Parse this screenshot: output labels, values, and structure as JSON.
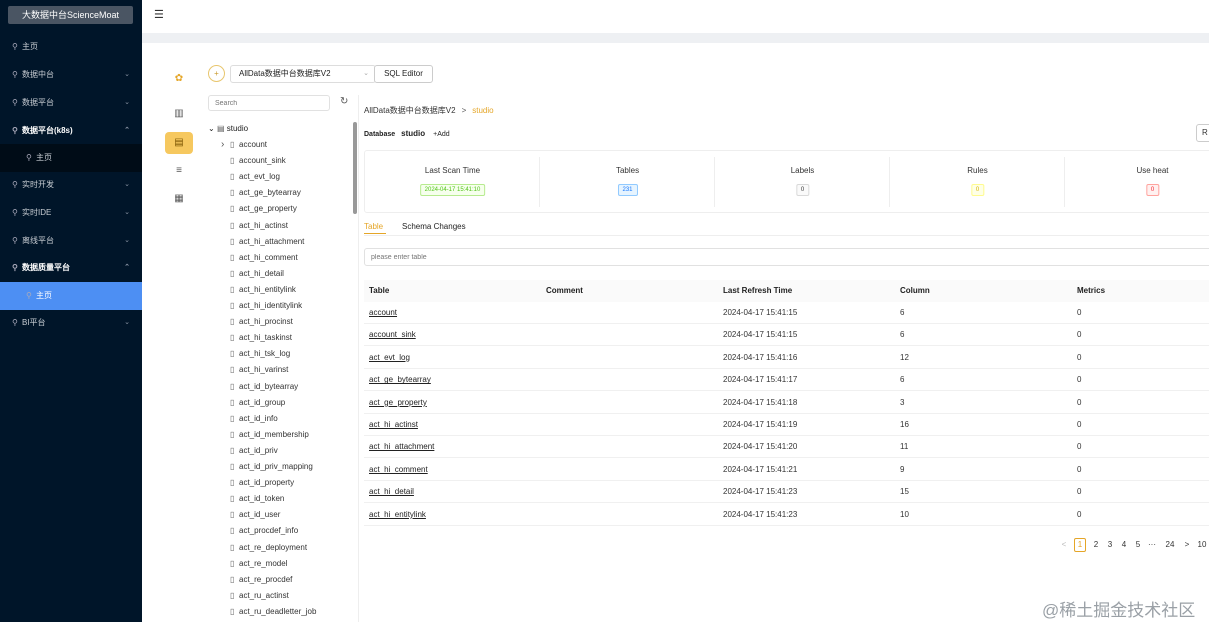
{
  "sidebar": {
    "brand": "大数据中台ScienceMoat",
    "items": [
      {
        "label": "主页",
        "chev": ""
      },
      {
        "label": "数据中台",
        "chev": "⌄"
      },
      {
        "label": "数据平台",
        "chev": "⌄"
      },
      {
        "label": "数据平台(k8s)",
        "chev": "⌃"
      },
      {
        "label": "主页",
        "chev": ""
      },
      {
        "label": "实时开发",
        "chev": "⌄"
      },
      {
        "label": "实时IDE",
        "chev": "⌄"
      },
      {
        "label": "离线平台",
        "chev": "⌄"
      },
      {
        "label": "数据质量平台",
        "chev": "⌃"
      },
      {
        "label": "主页",
        "chev": ""
      },
      {
        "label": "BI平台",
        "chev": "⌄"
      }
    ]
  },
  "toolbar": {
    "db_name": "AllData数据中台数据库V2",
    "sql_editor": "SQL Editor",
    "search_placeholder": "Search"
  },
  "tree": {
    "root": "studio",
    "items": [
      "account",
      "account_sink",
      "act_evt_log",
      "act_ge_bytearray",
      "act_ge_property",
      "act_hi_actinst",
      "act_hi_attachment",
      "act_hi_comment",
      "act_hi_detail",
      "act_hi_entitylink",
      "act_hi_identitylink",
      "act_hi_procinst",
      "act_hi_taskinst",
      "act_hi_tsk_log",
      "act_hi_varinst",
      "act_id_bytearray",
      "act_id_group",
      "act_id_info",
      "act_id_membership",
      "act_id_priv",
      "act_id_priv_mapping",
      "act_id_property",
      "act_id_token",
      "act_id_user",
      "act_procdef_info",
      "act_re_deployment",
      "act_re_model",
      "act_re_procdef",
      "act_ru_actinst",
      "act_ru_deadletter_job"
    ]
  },
  "breadcrumb": {
    "root": "AllData数据中台数据库V2",
    "current": "studio"
  },
  "database": {
    "label": "Database",
    "name": "studio",
    "add": "+Add",
    "right_btn": "R"
  },
  "stats": [
    {
      "label": "Last Scan Time",
      "value": "2024-04-17 15:41:10",
      "color": "#52c41a",
      "bg": "#f6ffed",
      "border": "#b7eb8f"
    },
    {
      "label": "Tables",
      "value": "231",
      "color": "#1677ff",
      "bg": "#e6f4ff",
      "border": "#91caff"
    },
    {
      "label": "Labels",
      "value": "0",
      "color": "#333",
      "bg": "#fafafa",
      "border": "#d9d9d9"
    },
    {
      "label": "Rules",
      "value": "0",
      "color": "#d4b106",
      "bg": "#feffe6",
      "border": "#fffb8f"
    },
    {
      "label": "Use heat",
      "value": "0",
      "color": "#f5222d",
      "bg": "#fff1f0",
      "border": "#ffa39e"
    }
  ],
  "tabs": {
    "table": "Table",
    "schema": "Schema Changes"
  },
  "filter_placeholder": "please enter table",
  "columns": [
    "Table",
    "Comment",
    "Last Refresh Time",
    "Column",
    "Metrics"
  ],
  "rows": [
    {
      "table": "account",
      "comment": "",
      "time": "2024-04-17 15:41:15",
      "column": "6",
      "metrics": "0"
    },
    {
      "table": "account_sink",
      "comment": "",
      "time": "2024-04-17 15:41:15",
      "column": "6",
      "metrics": "0"
    },
    {
      "table": "act_evt_log",
      "comment": "",
      "time": "2024-04-17 15:41:16",
      "column": "12",
      "metrics": "0"
    },
    {
      "table": "act_ge_bytearray",
      "comment": "",
      "time": "2024-04-17 15:41:17",
      "column": "6",
      "metrics": "0"
    },
    {
      "table": "act_ge_property",
      "comment": "",
      "time": "2024-04-17 15:41:18",
      "column": "3",
      "metrics": "0"
    },
    {
      "table": "act_hi_actinst",
      "comment": "",
      "time": "2024-04-17 15:41:19",
      "column": "16",
      "metrics": "0"
    },
    {
      "table": "act_hi_attachment",
      "comment": "",
      "time": "2024-04-17 15:41:20",
      "column": "11",
      "metrics": "0"
    },
    {
      "table": "act_hi_comment",
      "comment": "",
      "time": "2024-04-17 15:41:21",
      "column": "9",
      "metrics": "0"
    },
    {
      "table": "act_hi_detail",
      "comment": "",
      "time": "2024-04-17 15:41:23",
      "column": "15",
      "metrics": "0"
    },
    {
      "table": "act_hi_entitylink",
      "comment": "",
      "time": "2024-04-17 15:41:23",
      "column": "10",
      "metrics": "0"
    }
  ],
  "pager": {
    "prev": "<",
    "pages": [
      "1",
      "2",
      "3",
      "4",
      "5",
      "···",
      "24"
    ],
    "next": ">",
    "last": "10"
  },
  "watermark": "@稀土掘金技术社区"
}
